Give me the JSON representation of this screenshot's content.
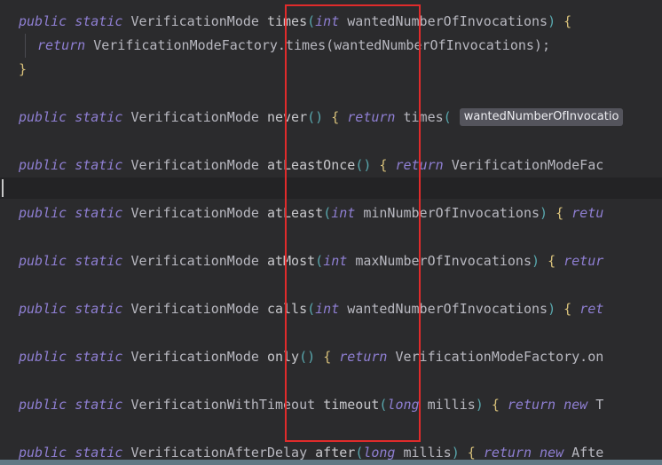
{
  "colors": {
    "background": "#2b2b2d",
    "keyword": "#8f7fd3",
    "identifier": "#b8b8c0",
    "bracket": "#59a8ae",
    "curly": "#d8c17a",
    "annotation_box": "#e02b2b",
    "hint_bg": "#54545c"
  },
  "code": {
    "line1": {
      "public": "public",
      "static": "static",
      "type": "VerificationMode",
      "method": "times",
      "open": "(",
      "ptype": "int",
      "param": "wantedNumberOfInvocations",
      "close": ")",
      "brace": "{"
    },
    "line2": {
      "return": "return",
      "body": "VerificationModeFactory.times(wantedNumberOfInvocations);"
    },
    "line3": {
      "brace": "}"
    },
    "line4": {
      "public": "public",
      "static": "static",
      "type": "VerificationMode",
      "method": "never",
      "parens": "()",
      "brace": "{",
      "return": "return",
      "call": "times",
      "open": "(",
      "hint": "wantedNumberOfInvocatio"
    },
    "line5": {
      "public": "public",
      "static": "static",
      "type": "VerificationMode",
      "method": "atLeastOnce",
      "parens": "()",
      "brace": "{",
      "return": "return",
      "body": "VerificationModeFac"
    },
    "line6": {
      "public": "public",
      "static": "static",
      "type": "VerificationMode",
      "method": "atLeast",
      "open": "(",
      "ptype": "int",
      "param": "minNumberOfInvocations",
      "close": ")",
      "brace": "{",
      "return": "retu"
    },
    "line7": {
      "public": "public",
      "static": "static",
      "type": "VerificationMode",
      "method": "atMost",
      "open": "(",
      "ptype": "int",
      "param": "maxNumberOfInvocations",
      "close": ")",
      "brace": "{",
      "return": "retur"
    },
    "line8": {
      "public": "public",
      "static": "static",
      "type": "VerificationMode",
      "method": "calls",
      "open": "(",
      "ptype": "int",
      "param": "wantedNumberOfInvocations",
      "close": ")",
      "brace": "{",
      "return": "ret"
    },
    "line9": {
      "public": "public",
      "static": "static",
      "type": "VerificationMode",
      "method": "only",
      "parens": "()",
      "brace": "{",
      "return": "return",
      "body": "VerificationModeFactory.on"
    },
    "line10": {
      "public": "public",
      "static": "static",
      "type": "VerificationWithTimeout",
      "method": "timeout",
      "open": "(",
      "ptype": "long",
      "param": "millis",
      "close": ")",
      "brace": "{",
      "return": "return",
      "new": "new",
      "rest": "T"
    },
    "line11": {
      "public": "public",
      "static": "static",
      "type": "VerificationAfterDelay",
      "method": "after",
      "open": "(",
      "ptype": "long",
      "param": "millis",
      "close": ")",
      "brace": "{",
      "return": "return",
      "new": "new",
      "rest": "Afte"
    }
  }
}
